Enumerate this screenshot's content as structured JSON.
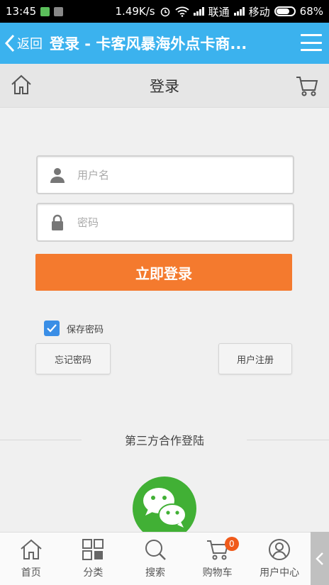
{
  "status_bar": {
    "time": "13:45",
    "speed": "1.49K/s",
    "carrier1": "联通",
    "carrier2": "移动",
    "battery": "68%"
  },
  "header": {
    "back_label": "返回",
    "title": "登录 - 卡客风暴海外点卡商..."
  },
  "subheader": {
    "title": "登录"
  },
  "form": {
    "username_placeholder": "用户名",
    "username_value": "",
    "password_placeholder": "密码",
    "password_value": "",
    "login_button": "立即登录",
    "remember_label": "保存密码",
    "remember_checked": true,
    "forgot_button": "忘记密码",
    "register_button": "用户注册"
  },
  "third_party": {
    "title": "第三方合作登陆",
    "provider_icon": "wechat-icon"
  },
  "tabbar": {
    "items": [
      {
        "label": "首页",
        "icon": "home-icon"
      },
      {
        "label": "分类",
        "icon": "grid-icon"
      },
      {
        "label": "搜索",
        "icon": "search-icon"
      },
      {
        "label": "购物车",
        "icon": "cart-icon",
        "badge": "0"
      },
      {
        "label": "用户中心",
        "icon": "user-icon"
      }
    ]
  },
  "colors": {
    "header_bg": "#3bb2ee",
    "login_button": "#f47a2e",
    "checkbox": "#3a8ee6",
    "wechat": "#41b035",
    "badge": "#f05a1a"
  }
}
